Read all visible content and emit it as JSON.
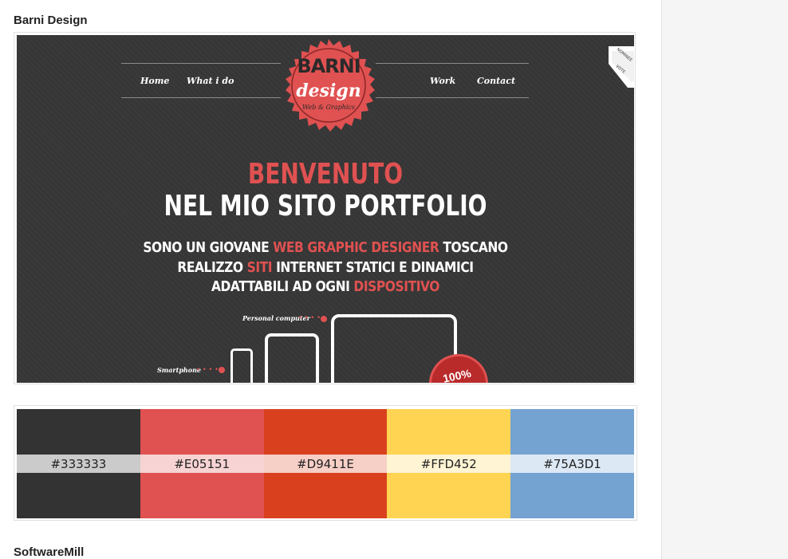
{
  "sections": [
    {
      "title": "Barni Design"
    },
    {
      "title": "SoftwareMill"
    }
  ],
  "preview": {
    "nav_left": [
      "Home",
      "What i do"
    ],
    "nav_right": [
      "Work",
      "Contact"
    ],
    "logo": {
      "line1": "BARNI",
      "line2": "design",
      "line3": "Web & Graphics"
    },
    "hero": {
      "line1": "BENVENUTO",
      "line2": "NEL MIO SITO PORTFOLIO",
      "p1": {
        "a": "SONO UN GIOVANE ",
        "b": "WEB GRAPHIC DESIGNER",
        "c": " TOSCANO"
      },
      "p2": {
        "a": "REALIZZO ",
        "b": "SITI",
        "c": " INTERNET STATICI E DINAMICI"
      },
      "p3": {
        "a": "ADATTABILI AD OGNI ",
        "b": "DISPOSITIVO"
      }
    },
    "devices": {
      "pc_label": "Personal computer",
      "phone_label": "Smartphone"
    },
    "badge_text": "100%",
    "ribbon": {
      "top": "NOMINEE",
      "bottom": "VOTE"
    }
  },
  "palette": [
    {
      "color": "#333333",
      "label": "#333333"
    },
    {
      "color": "#E05151",
      "label": "#E05151"
    },
    {
      "color": "#D9411E",
      "label": "#D9411E"
    },
    {
      "color": "#FFD452",
      "label": "#FFD452"
    },
    {
      "color": "#75A3D1",
      "label": "#75A3D1"
    }
  ]
}
